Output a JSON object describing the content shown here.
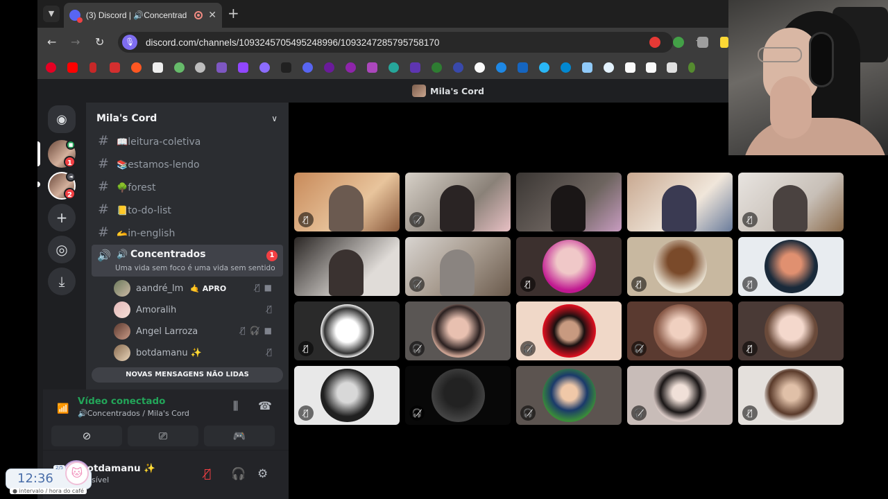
{
  "browser": {
    "tab_title": "(3) Discord | 🔊Concentrad",
    "url": "discord.com/channels/1093245705495248996/1093247285795758170"
  },
  "discord": {
    "window_title": "Mila's Cord",
    "server_name": "Mila's Cord",
    "rail_badges": [
      "1",
      "2"
    ],
    "channels": [
      {
        "emoji": "📖",
        "name": "leitura-coletiva"
      },
      {
        "emoji": "📚",
        "name": "estamos-lendo"
      },
      {
        "emoji": "🌳",
        "name": "forest"
      },
      {
        "emoji": "📒",
        "name": "to-do-list"
      },
      {
        "emoji": "🫴",
        "name": "in-english"
      }
    ],
    "voice_channel": {
      "emoji": "🔊",
      "name": "Concentrados",
      "status": "Uma vida sem foco é uma vida sem sentido",
      "badge": "1"
    },
    "voice_users": [
      {
        "name": "aandré_lm",
        "tag": "🤙 APRO"
      },
      {
        "name": "Amoralih",
        "tag": ""
      },
      {
        "name": "Angel Larroza",
        "tag": ""
      },
      {
        "name": "botdamanu ✨",
        "tag": ""
      }
    ],
    "new_messages_label": "NOVAS MENSAGENS NÃO LIDAS",
    "rtc": {
      "title": "Vídeo conectado",
      "subtitle": "🔊Concentrados / Mila's Cord"
    },
    "user": {
      "name": "botdamanu ✨",
      "status": "sível"
    }
  },
  "clock": {
    "time": "12:36",
    "fraction": "2/5",
    "caption": "● intervalo / hora do café"
  },
  "colors": {
    "accent": "#5865f2",
    "online_green": "#23a559",
    "badge_red": "#f23f43",
    "sidebar_bg": "#2b2d31",
    "rail_bg": "#1e1f22"
  }
}
